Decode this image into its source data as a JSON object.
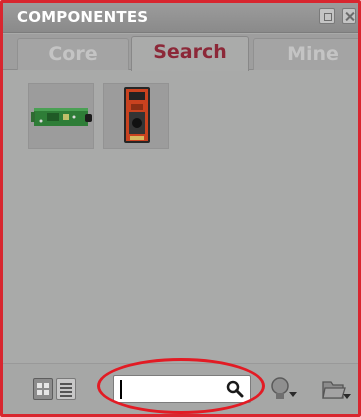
{
  "panel": {
    "title": "COMPONENTES"
  },
  "tabs": [
    {
      "label": "Core",
      "active": false
    },
    {
      "label": "Search",
      "active": true
    },
    {
      "label": "Mine",
      "active": false
    }
  ],
  "components": [
    {
      "icon": "green-pcb-board-icon"
    },
    {
      "icon": "red-sensor-module-icon"
    }
  ],
  "toolbar": {
    "view_mode": "grid",
    "search": {
      "value": "",
      "placeholder": ""
    },
    "buttons": [
      {
        "icon": "grid-view-icon"
      },
      {
        "icon": "list-view-icon"
      },
      {
        "icon": "magnifier-icon"
      },
      {
        "icon": "lightbulb-dropdown-icon"
      },
      {
        "icon": "folder-dropdown-icon"
      }
    ]
  },
  "colors": {
    "active_tab_text": "#8c2838",
    "highlight": "#e21b24",
    "panel_background": "#a9aaa9"
  }
}
